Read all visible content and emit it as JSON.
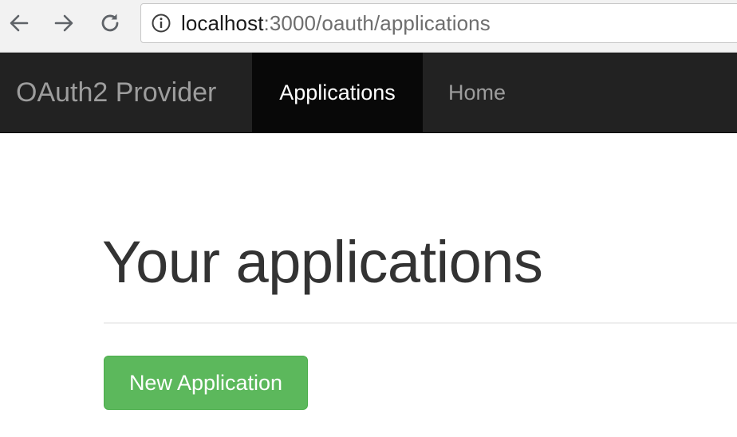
{
  "browser": {
    "back_icon": "arrow-left-icon",
    "forward_icon": "arrow-right-icon",
    "reload_icon": "reload-icon",
    "info_icon": "info-circle-icon",
    "url_host": "localhost",
    "url_rest": ":3000/oauth/applications"
  },
  "navbar": {
    "brand": "OAuth2 Provider",
    "items": [
      {
        "label": "Applications",
        "active": true
      },
      {
        "label": "Home",
        "active": false
      }
    ],
    "colors": {
      "background": "#222222",
      "active_background": "#080808",
      "text": "#9d9d9d",
      "active_text": "#ffffff"
    }
  },
  "main": {
    "title": "Your applications",
    "new_application_button": "New Application",
    "button_color": "#5cb85c"
  }
}
